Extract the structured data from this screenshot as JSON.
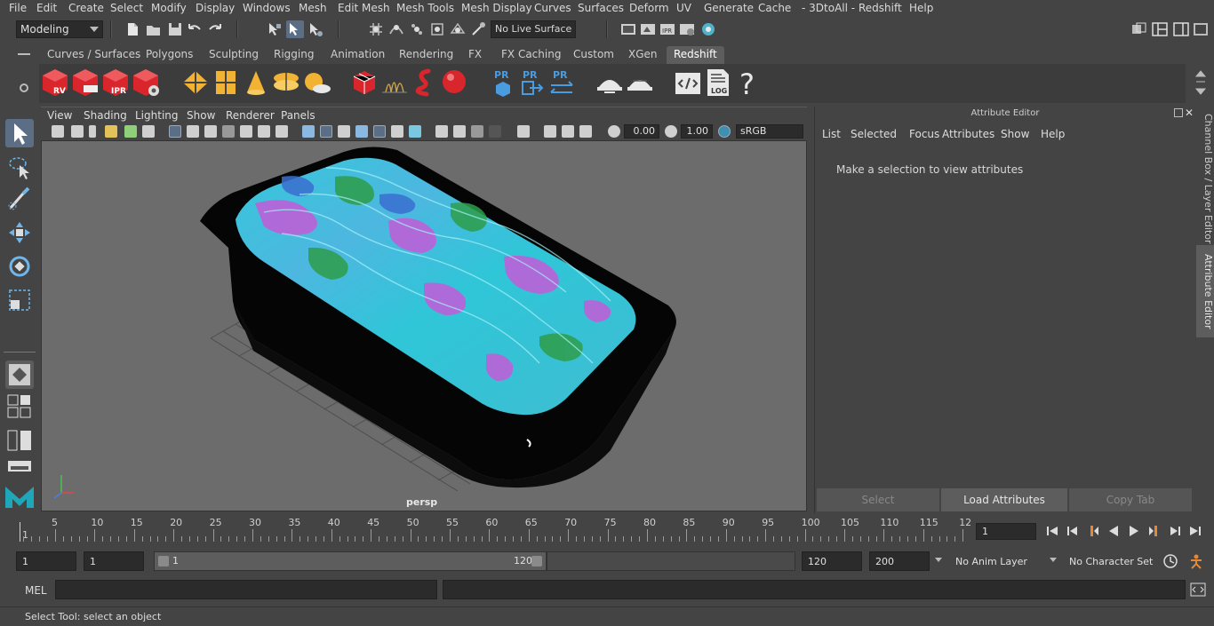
{
  "menubar": {
    "items": [
      "File",
      "Edit",
      "Create",
      "Select",
      "Modify",
      "Display",
      "Windows",
      "Mesh",
      "Edit Mesh",
      "Mesh Tools",
      "Mesh Display",
      "Curves",
      "Surfaces",
      "Deform",
      "UV",
      "Generate",
      "Cache",
      "- 3DtoAll -",
      "Redshift",
      "Help"
    ]
  },
  "statusline": {
    "mode": "Modeling",
    "live_surface": "No Live Surface"
  },
  "shelf": {
    "tabs": [
      "Curves / Surfaces",
      "Polygons",
      "Sculpting",
      "Rigging",
      "Animation",
      "Rendering",
      "FX",
      "FX Caching",
      "Custom",
      "XGen",
      "Redshift"
    ],
    "active_tab": "Redshift",
    "icon_labels": {
      "rv": "RV",
      "ipr": "IPR",
      "pr": "PR",
      "log": "LOG",
      "help": "?"
    }
  },
  "viewport": {
    "menus": [
      "View",
      "Shading",
      "Lighting",
      "Show",
      "Renderer",
      "Panels"
    ],
    "exposure": "0.00",
    "gamma": "1.00",
    "color_space": "sRGB gamma",
    "camera_label": "persp"
  },
  "attribute_editor": {
    "title": "Attribute Editor",
    "menus": [
      "List",
      "Selected",
      "Focus",
      "Attributes",
      "Show",
      "Help"
    ],
    "message": "Make a selection to view attributes",
    "buttons": {
      "select": "Select",
      "load": "Load Attributes",
      "copy": "Copy Tab"
    }
  },
  "side_tabs": {
    "channel_box": "Channel Box / Layer Editor",
    "attribute_editor": "Attribute Editor"
  },
  "timeline": {
    "start_label": "1",
    "tick_labels": [
      "5",
      "10",
      "15",
      "20",
      "25",
      "30",
      "35",
      "40",
      "45",
      "50",
      "55",
      "60",
      "65",
      "70",
      "75",
      "80",
      "85",
      "90",
      "95",
      "100",
      "105",
      "110",
      "115",
      "12"
    ],
    "current_frame": "1"
  },
  "range": {
    "start": "1",
    "playback_start": "1",
    "slider_start": "1",
    "slider_end": "120",
    "playback_end": "120",
    "end": "200",
    "anim_layer": "No Anim Layer",
    "character_set": "No Character Set"
  },
  "command_line": {
    "language": "MEL"
  },
  "help_line": {
    "text": "Select Tool: select an object"
  },
  "colors": {
    "accent": "#5b6e86",
    "redshift_red": "#d9262c",
    "mesh_cyan": "#2fc6d8",
    "mesh_magenta": "#c45bd8",
    "mesh_green": "#2e9d4a"
  }
}
